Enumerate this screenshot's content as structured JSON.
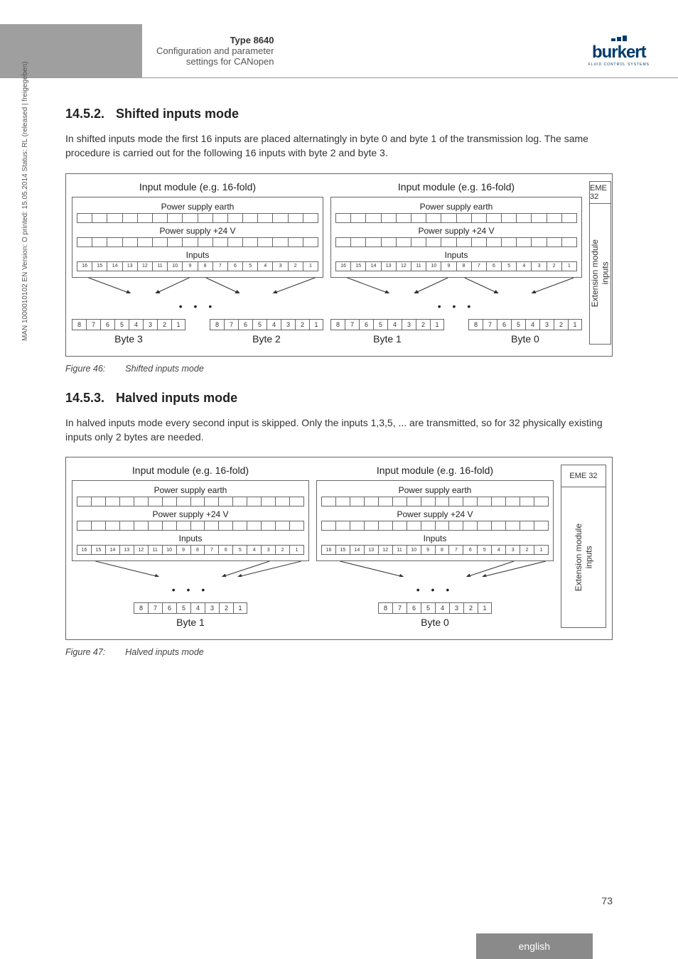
{
  "header": {
    "type_label": "Type 8640",
    "subtitle_line1": "Configuration and parameter",
    "subtitle_line2": "settings for CANopen",
    "logo_text": "burkert",
    "logo_sub": "FLUID CONTROL SYSTEMS"
  },
  "spine_text": "MAN 1000010102 EN Version: O printed: 15.05.2014 Status: RL (released | freigegeben)",
  "page_number": "73",
  "language_tab": "english",
  "section_1": {
    "number": "14.5.2.",
    "title": "Shifted inputs mode",
    "paragraph": "In shifted inputs mode the first 16 inputs are placed alternatingly in byte 0 and byte 1 of the transmission log. The same procedure is carried out for the following 16 inputs with byte 2 and byte 3.",
    "figure_num": "Figure 46:",
    "figure_caption": "Shifted inputs mode"
  },
  "section_2": {
    "number": "14.5.3.",
    "title": "Halved inputs mode",
    "paragraph": "In halved inputs mode every second input is skipped. Only the inputs 1,3,5, ... are transmitted, so for 32 physically existing inputs only 2 bytes are needed.",
    "figure_num": "Figure 47:",
    "figure_caption": "Halved inputs mode"
  },
  "diagram_labels": {
    "module_title": "Input module (e.g. 16-fold)",
    "earth": "Power supply earth",
    "v24": "Power supply +24 V",
    "inputs": "Inputs",
    "ellipsis": "• • •",
    "side_top": "EME 32",
    "side_bottom_line1": "Extension module",
    "side_bottom_line2": "inputs"
  },
  "bytes": {
    "byte0": "Byte 0",
    "byte1": "Byte 1",
    "byte2": "Byte 2",
    "byte3": "Byte 3"
  },
  "pins_16": [
    "16",
    "15",
    "14",
    "13",
    "12",
    "11",
    "10",
    "9",
    "8",
    "7",
    "6",
    "5",
    "4",
    "3",
    "2",
    "1"
  ],
  "pins_8": [
    "8",
    "7",
    "6",
    "5",
    "4",
    "3",
    "2",
    "1"
  ]
}
